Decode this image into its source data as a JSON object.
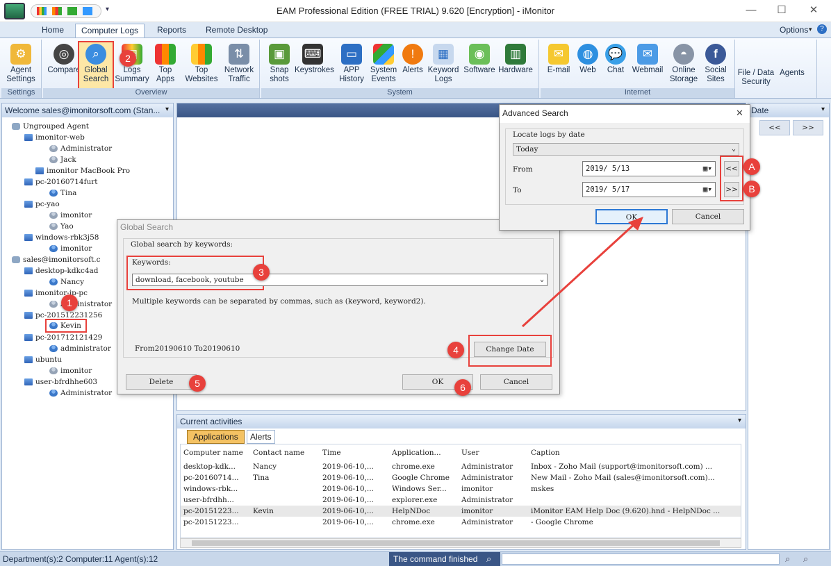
{
  "app": {
    "title": "EAM Professional Edition (FREE TRIAL) 9.620 [Encryption] - iMonitor",
    "options_label": "Options"
  },
  "tabs": [
    "Home",
    "Computer Logs",
    "Reports",
    "Remote Desktop"
  ],
  "ribbon": {
    "settings": {
      "label": "Settings",
      "buttons": [
        {
          "label": "Agent\nSettings"
        }
      ]
    },
    "overview": {
      "label": "Overview",
      "buttons": [
        {
          "label": "Compare"
        },
        {
          "label": "Global\nSearch"
        },
        {
          "label": "Logs\nSummary"
        },
        {
          "label": "Top\nApps"
        },
        {
          "label": "Top\nWebsites"
        },
        {
          "label": "Network\nTraffic"
        }
      ]
    },
    "system": {
      "label": "System",
      "buttons": [
        {
          "label": "Snap\nshots"
        },
        {
          "label": "Keystrokes"
        },
        {
          "label": "APP\nHistory"
        },
        {
          "label": "System\nEvents"
        },
        {
          "label": "Alerts"
        },
        {
          "label": "Keyword\nLogs"
        },
        {
          "label": "Software"
        },
        {
          "label": "Hardware"
        }
      ]
    },
    "internet": {
      "label": "Internet",
      "buttons": [
        {
          "label": "E-mail"
        },
        {
          "label": "Web"
        },
        {
          "label": "Chat"
        },
        {
          "label": "Webmail"
        },
        {
          "label": "Online\nStorage"
        },
        {
          "label": "Social\nSites"
        }
      ]
    },
    "extra": [
      {
        "label": "File / Data\nSecurity"
      },
      {
        "label": "Agents"
      }
    ]
  },
  "left_panel": {
    "header": "Welcome sales@imonitorsoft.com (Stan...",
    "tree": [
      {
        "label": "Ungrouped Agent",
        "type": "group",
        "level": 0
      },
      {
        "label": "imonitor-web",
        "type": "pc",
        "level": 1
      },
      {
        "label": "Administrator",
        "type": "user-grey",
        "level": 2
      },
      {
        "label": "Jack",
        "type": "user-grey",
        "level": 2
      },
      {
        "label": "imonitor MacBook Pro",
        "type": "pc",
        "level": 1
      },
      {
        "label": "pc-20160714furt",
        "type": "pc",
        "level": 1
      },
      {
        "label": "Tina",
        "type": "user",
        "level": 2
      },
      {
        "label": "pc-yao",
        "type": "pc",
        "level": 1
      },
      {
        "label": "imonitor",
        "type": "user-grey",
        "level": 2
      },
      {
        "label": "Yao",
        "type": "user-grey",
        "level": 2
      },
      {
        "label": "windows-rbk3j58",
        "type": "pc",
        "level": 1
      },
      {
        "label": "imonitor",
        "type": "user",
        "level": 2
      },
      {
        "label": "sales@imonitorsoft.c",
        "type": "group",
        "level": 0
      },
      {
        "label": "desktop-kdkc4ad",
        "type": "pc",
        "level": 1
      },
      {
        "label": "Nancy",
        "type": "user",
        "level": 2
      },
      {
        "label": "imonitor-jp-pc",
        "type": "pc",
        "level": 1
      },
      {
        "label": "Administrator",
        "type": "user-grey",
        "level": 2
      },
      {
        "label": "pc-201512231256",
        "type": "pc",
        "level": 1
      },
      {
        "label": "Kevin",
        "type": "user",
        "level": 2
      },
      {
        "label": "pc-201712121429",
        "type": "pc",
        "level": 1
      },
      {
        "label": "administrator",
        "type": "user",
        "level": 2
      },
      {
        "label": "ubuntu",
        "type": "pc",
        "level": 1
      },
      {
        "label": "imonitor",
        "type": "user-grey",
        "level": 2
      },
      {
        "label": "user-bfrdhhe603",
        "type": "pc",
        "level": 1
      },
      {
        "label": "Administrator",
        "type": "user",
        "level": 2
      }
    ]
  },
  "right_panel": {
    "header": "Date",
    "prev": "<<",
    "next": ">>"
  },
  "global_search": {
    "title": "Global Search",
    "group_label": "Global search by keywords:",
    "keywords_label": "Keywords:",
    "keywords_value": "download, facebook, youtube",
    "hint": "Multiple keywords can be separated by commas, such as (keyword, keyword2).",
    "date_range": "From20190610 To20190610",
    "change_date": "Change Date",
    "delete": "Delete",
    "ok": "OK",
    "cancel": "Cancel"
  },
  "advanced_search": {
    "title": "Advanced Search",
    "group_label": "Locate logs by date",
    "preset": "Today",
    "from_label": "From",
    "from_value": "2019/ 5/13",
    "to_label": "To",
    "to_value": "2019/ 5/17",
    "prev_btn": "<<",
    "next_btn": ">>",
    "ok": "OK",
    "cancel": "Cancel",
    "close": "✕"
  },
  "annotations": [
    "1",
    "2",
    "3",
    "4",
    "5",
    "6",
    "A",
    "B"
  ],
  "activities": {
    "header": "Current activities",
    "tabs": [
      "Applications",
      "Alerts"
    ],
    "columns": [
      "Computer name",
      "Contact name",
      "Time",
      "Application...",
      "User",
      "Caption"
    ],
    "rows": [
      [
        "desktop-kdk...",
        "Nancy",
        "2019-06-10,...",
        "chrome.exe",
        "Administrator",
        "Inbox - Zoho Mail (support@imonitorsoft.com) ..."
      ],
      [
        "pc-20160714...",
        "Tina",
        "2019-06-10,...",
        "Google Chrome",
        "Administrator",
        "New Mail - Zoho Mail (sales@imonitorsoft.com)..."
      ],
      [
        "windows-rbk...",
        "",
        "2019-06-10,...",
        "Windows Ser...",
        "imonitor",
        "mskes"
      ],
      [
        "user-bfrdhh...",
        "",
        "2019-06-10,...",
        "explorer.exe",
        "Administrator",
        ""
      ],
      [
        "pc-20151223...",
        "Kevin",
        "2019-06-10,...",
        "HelpNDoc",
        "imonitor",
        "iMonitor EAM Help Doc (9.620).hnd - HelpNDoc ..."
      ],
      [
        "pc-20151223...",
        "",
        "2019-06-10,...",
        "chrome.exe",
        "Administrator",
        "- Google Chrome"
      ]
    ]
  },
  "status": {
    "left": "Department(s):2  Computer:11  Agent(s):12",
    "message": "The command finished"
  },
  "colors": {
    "accent_red": "#e8413c",
    "ribbon_blue": "#1b2f4a",
    "tab_orange": "#f4c263"
  }
}
